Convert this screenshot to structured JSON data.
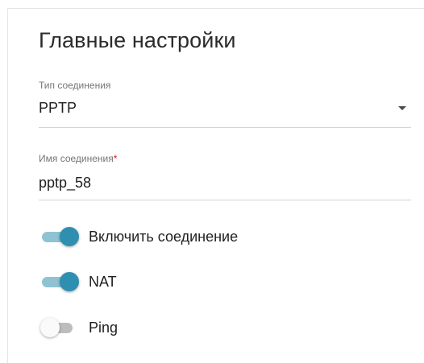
{
  "section": {
    "title": "Главные настройки"
  },
  "connection_type": {
    "label": "Тип соединения",
    "value": "PPTP"
  },
  "connection_name": {
    "label": "Имя соединения",
    "required_mark": "*",
    "value": "pptp_58"
  },
  "toggles": [
    {
      "label": "Включить соединение",
      "checked": true
    },
    {
      "label": "NAT",
      "checked": true
    },
    {
      "label": "Ping",
      "checked": false
    }
  ],
  "colors": {
    "accent": "#2f8fb0",
    "accent_track": "#8fc3d3",
    "required": "#e0161c"
  },
  "icons": {
    "dropdown": "chevron-down-icon"
  }
}
